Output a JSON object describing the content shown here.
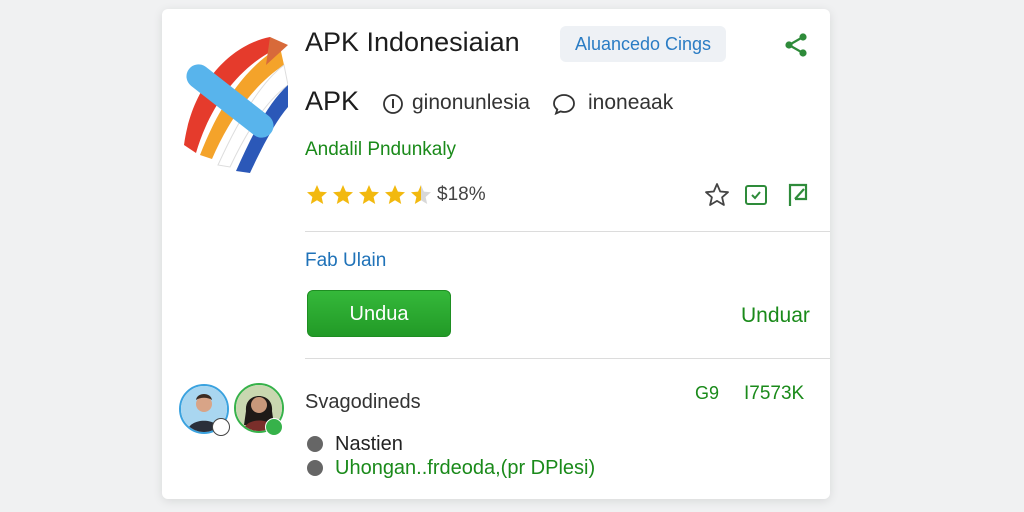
{
  "app": {
    "title": "APK Indonesiaian",
    "badge": "Aluancedo Cings",
    "type_label": "APK",
    "developer": "ginonunlesia",
    "region": "inoneaak",
    "category": "Andalil Pndunkaly",
    "rating": {
      "stars": 4.5,
      "text": "$18%"
    }
  },
  "download": {
    "section_label": "Fab Ulain",
    "primary_label": "Undua",
    "secondary_label": "Unduar"
  },
  "reviews": {
    "label": "Svagodineds",
    "stat_a": "G9",
    "stat_b": "I7573K",
    "bullets": [
      {
        "text": "Nastien"
      },
      {
        "text": "Uhongan..frdeoda,(pr DPlesi)"
      }
    ]
  },
  "colors": {
    "accent_green": "#229a27",
    "link_blue": "#2a7cc4",
    "star_yellow": "#f2b90f"
  },
  "icons": {
    "share": "share-icon",
    "developer": "info-circle-icon",
    "region": "chat-bubble-icon",
    "favorite": "star-outline-icon",
    "save": "bookmark-check-icon",
    "report": "flag-icon"
  }
}
